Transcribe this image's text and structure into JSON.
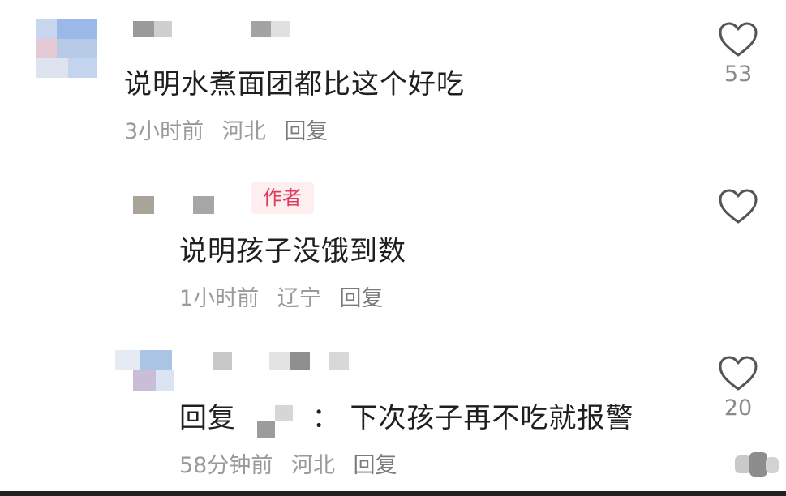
{
  "comments": [
    {
      "text": "说明水煮面团都比这个好吃",
      "time": "3小时前",
      "location": "河北",
      "reply_label": "回复",
      "likes": "53"
    },
    {
      "badge": "作者",
      "text": "说明孩子没饿到数",
      "time": "1小时前",
      "location": "辽宁",
      "reply_label": "回复",
      "likes": ""
    },
    {
      "reply_prefix": "回复",
      "text_separator": "：",
      "text": "下次孩子再不吃就报警",
      "time": "58分钟前",
      "location": "河北",
      "reply_label": "回复",
      "likes": "20"
    }
  ],
  "icons": {
    "like": "heart-outline-icon"
  },
  "colors": {
    "author_badge_bg": "#fdeef0",
    "author_badge_text": "#e23a5b",
    "meta_text": "#9a9a9a"
  }
}
